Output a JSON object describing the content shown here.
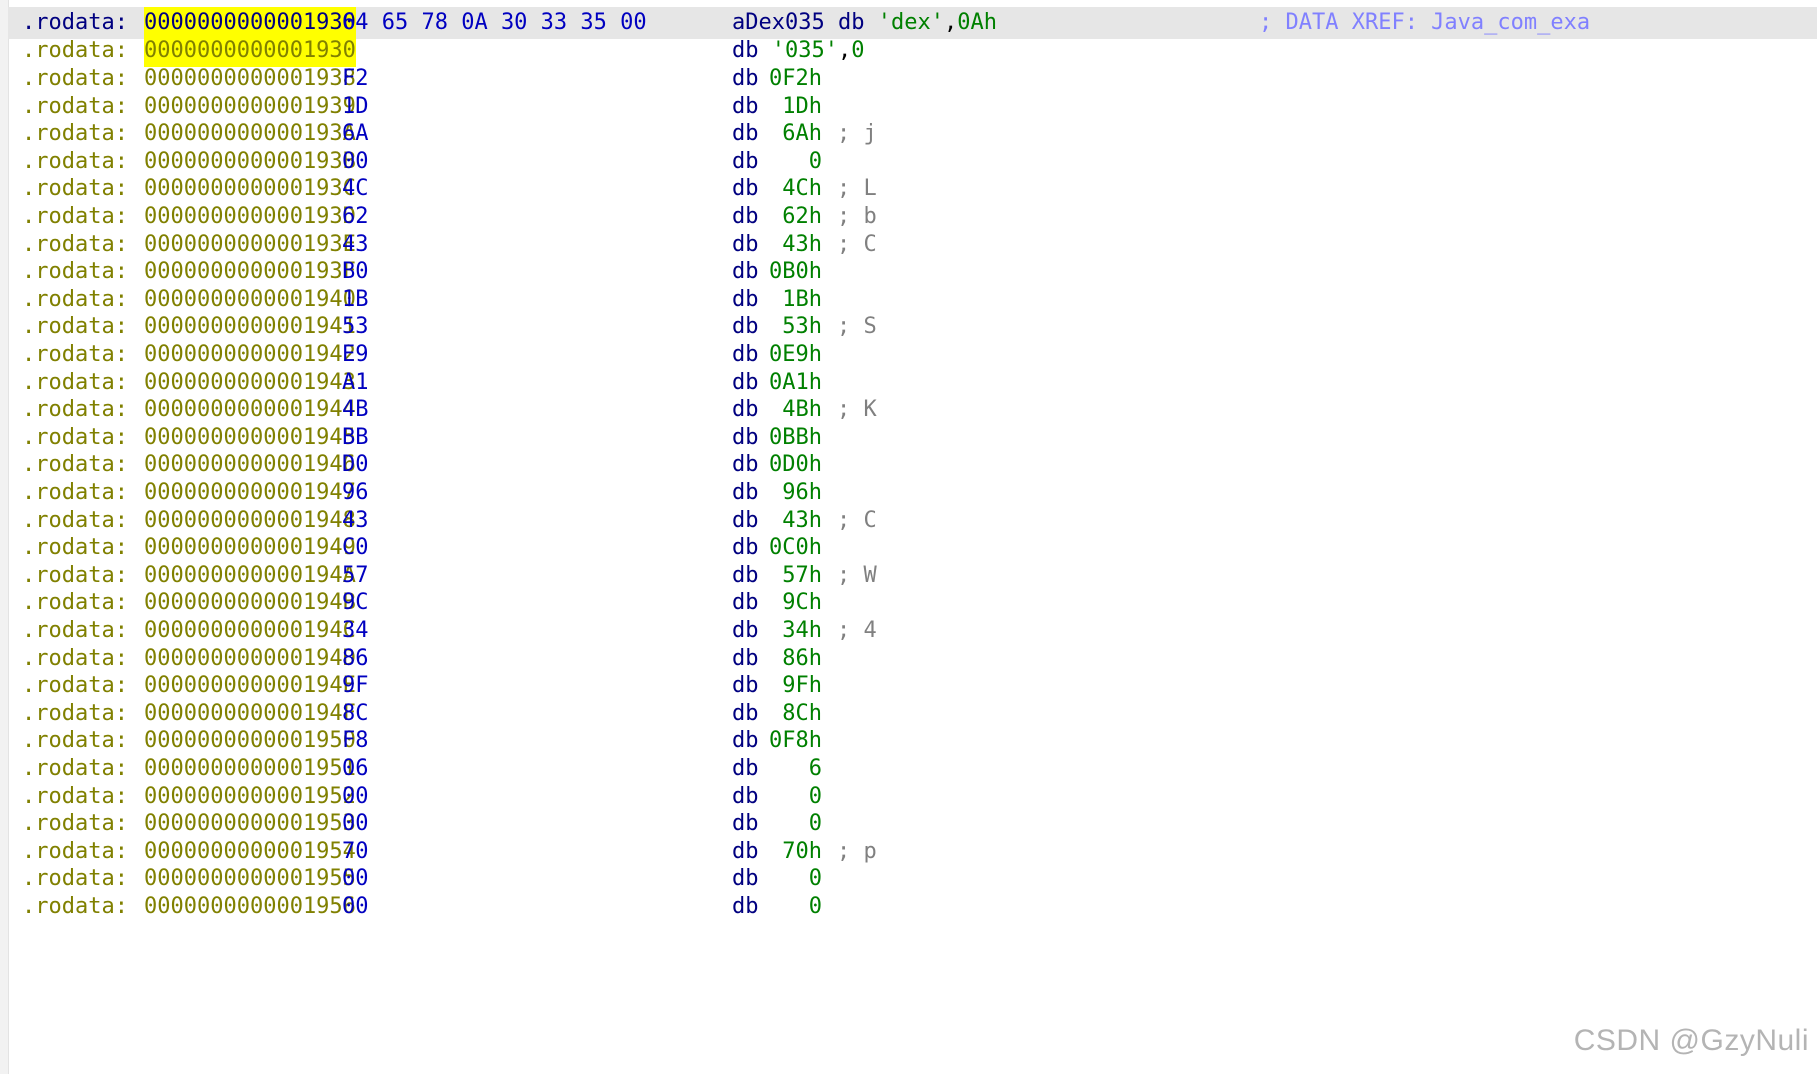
{
  "segment": ".rodata",
  "header_row": {
    "prefix": ".rodata:",
    "addr": "0000000000001930",
    "bytes": "64 65 78 0A 30 33 35 00",
    "label": "aDex035",
    "op": "db",
    "val_str": "'dex'",
    "val_sep": ",",
    "val_num": "0Ah",
    "xref": "; DATA XREF: Java_com_exa"
  },
  "second_row": {
    "prefix": ".rodata:",
    "addr": "0000000000001930",
    "op": "db",
    "val_str": "'035'",
    "val_sep": ",",
    "val_num": "0"
  },
  "rows": [
    {
      "prefix": ".rodata:",
      "addr": "0000000000001938",
      "byte": "F2",
      "op": "db",
      "val": "0F2h",
      "cmt": ""
    },
    {
      "prefix": ".rodata:",
      "addr": "0000000000001939",
      "byte": "1D",
      "op": "db",
      "val": " 1Dh",
      "cmt": ""
    },
    {
      "prefix": ".rodata:",
      "addr": "000000000000193A",
      "byte": "6A",
      "op": "db",
      "val": " 6Ah",
      "cmt": "; j"
    },
    {
      "prefix": ".rodata:",
      "addr": "000000000000193B",
      "byte": "00",
      "op": "db",
      "val": "   0",
      "cmt": ""
    },
    {
      "prefix": ".rodata:",
      "addr": "000000000000193C",
      "byte": "4C",
      "op": "db",
      "val": " 4Ch",
      "cmt": "; L"
    },
    {
      "prefix": ".rodata:",
      "addr": "000000000000193D",
      "byte": "62",
      "op": "db",
      "val": " 62h",
      "cmt": "; b"
    },
    {
      "prefix": ".rodata:",
      "addr": "000000000000193E",
      "byte": "43",
      "op": "db",
      "val": " 43h",
      "cmt": "; C"
    },
    {
      "prefix": ".rodata:",
      "addr": "000000000000193F",
      "byte": "B0",
      "op": "db",
      "val": "0B0h",
      "cmt": ""
    },
    {
      "prefix": ".rodata:",
      "addr": "0000000000001940",
      "byte": "1B",
      "op": "db",
      "val": " 1Bh",
      "cmt": ""
    },
    {
      "prefix": ".rodata:",
      "addr": "0000000000001941",
      "byte": "53",
      "op": "db",
      "val": " 53h",
      "cmt": "; S"
    },
    {
      "prefix": ".rodata:",
      "addr": "0000000000001942",
      "byte": "E9",
      "op": "db",
      "val": "0E9h",
      "cmt": ""
    },
    {
      "prefix": ".rodata:",
      "addr": "0000000000001943",
      "byte": "A1",
      "op": "db",
      "val": "0A1h",
      "cmt": ""
    },
    {
      "prefix": ".rodata:",
      "addr": "0000000000001944",
      "byte": "4B",
      "op": "db",
      "val": " 4Bh",
      "cmt": "; K"
    },
    {
      "prefix": ".rodata:",
      "addr": "0000000000001945",
      "byte": "BB",
      "op": "db",
      "val": "0BBh",
      "cmt": ""
    },
    {
      "prefix": ".rodata:",
      "addr": "0000000000001946",
      "byte": "D0",
      "op": "db",
      "val": "0D0h",
      "cmt": ""
    },
    {
      "prefix": ".rodata:",
      "addr": "0000000000001947",
      "byte": "96",
      "op": "db",
      "val": " 96h",
      "cmt": ""
    },
    {
      "prefix": ".rodata:",
      "addr": "0000000000001948",
      "byte": "43",
      "op": "db",
      "val": " 43h",
      "cmt": "; C"
    },
    {
      "prefix": ".rodata:",
      "addr": "0000000000001949",
      "byte": "C0",
      "op": "db",
      "val": "0C0h",
      "cmt": ""
    },
    {
      "prefix": ".rodata:",
      "addr": "000000000000194A",
      "byte": "57",
      "op": "db",
      "val": " 57h",
      "cmt": "; W"
    },
    {
      "prefix": ".rodata:",
      "addr": "000000000000194B",
      "byte": "9C",
      "op": "db",
      "val": " 9Ch",
      "cmt": ""
    },
    {
      "prefix": ".rodata:",
      "addr": "000000000000194C",
      "byte": "34",
      "op": "db",
      "val": " 34h",
      "cmt": "; 4"
    },
    {
      "prefix": ".rodata:",
      "addr": "000000000000194D",
      "byte": "86",
      "op": "db",
      "val": " 86h",
      "cmt": ""
    },
    {
      "prefix": ".rodata:",
      "addr": "000000000000194E",
      "byte": "9F",
      "op": "db",
      "val": " 9Fh",
      "cmt": ""
    },
    {
      "prefix": ".rodata:",
      "addr": "000000000000194F",
      "byte": "8C",
      "op": "db",
      "val": " 8Ch",
      "cmt": ""
    },
    {
      "prefix": ".rodata:",
      "addr": "0000000000001950",
      "byte": "F8",
      "op": "db",
      "val": "0F8h",
      "cmt": ""
    },
    {
      "prefix": ".rodata:",
      "addr": "0000000000001951",
      "byte": "06",
      "op": "db",
      "val": "   6",
      "cmt": ""
    },
    {
      "prefix": ".rodata:",
      "addr": "0000000000001952",
      "byte": "00",
      "op": "db",
      "val": "   0",
      "cmt": ""
    },
    {
      "prefix": ".rodata:",
      "addr": "0000000000001953",
      "byte": "00",
      "op": "db",
      "val": "   0",
      "cmt": ""
    },
    {
      "prefix": ".rodata:",
      "addr": "0000000000001954",
      "byte": "70",
      "op": "db",
      "val": " 70h",
      "cmt": "; p"
    },
    {
      "prefix": ".rodata:",
      "addr": "0000000000001955",
      "byte": "00",
      "op": "db",
      "val": "   0",
      "cmt": ""
    },
    {
      "prefix": ".rodata:",
      "addr": "0000000000001956",
      "byte": "00",
      "op": "db",
      "val": "   0",
      "cmt": ""
    }
  ],
  "watermark": "CSDN @GzyNuli",
  "colors": {
    "segment_prefix": "#808000",
    "current_line_text": "#000080",
    "byte_hex": "#0000c0",
    "data_value": "#008000",
    "comment": "#808080",
    "xref_comment": "#8080ff",
    "address_highlight": "#ffff00",
    "current_line_bg": "#e6e6e6"
  }
}
